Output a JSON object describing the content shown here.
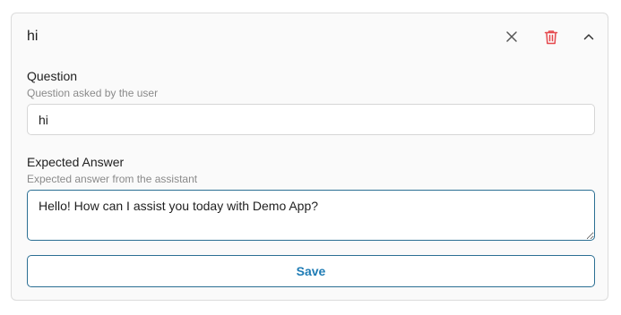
{
  "card": {
    "title": "hi",
    "actions": {
      "clear_icon": "close-icon",
      "delete_icon": "trash-icon",
      "collapse_icon": "chevron-up-icon",
      "delete_color": "#e5484d",
      "icon_color": "#555555"
    }
  },
  "question": {
    "label": "Question",
    "help": "Question asked by the user",
    "value": "hi"
  },
  "answer": {
    "label": "Expected Answer",
    "help": "Expected answer from the assistant",
    "value": "Hello! How can I assist you today with Demo App?"
  },
  "save_label": "Save",
  "colors": {
    "accent": "#1f7cb5",
    "focus_border": "#2b6f93"
  }
}
